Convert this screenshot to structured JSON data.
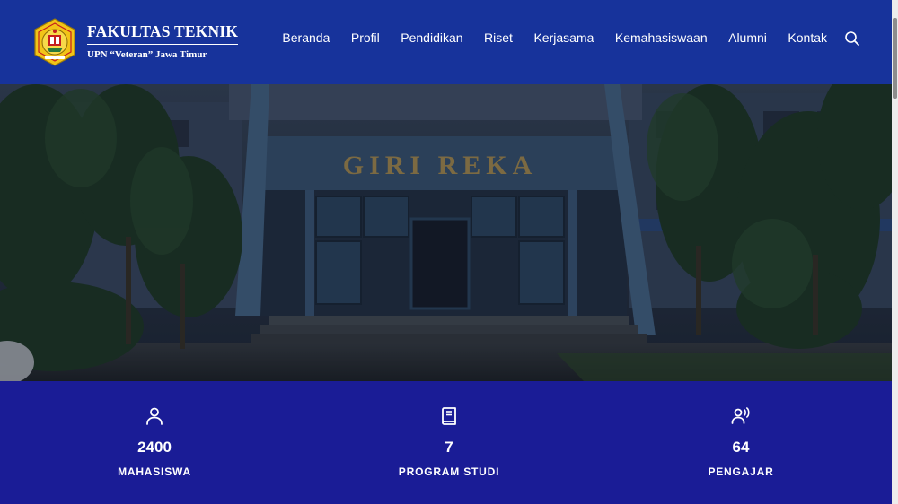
{
  "brand": {
    "title": "FAKULTAS TEKNIK",
    "subtitle": "UPN “Veteran” Jawa Timur",
    "logo_icon": "university-seal-logo"
  },
  "nav": {
    "items": [
      {
        "label": "Beranda"
      },
      {
        "label": "Profil"
      },
      {
        "label": "Pendidikan"
      },
      {
        "label": "Riset"
      },
      {
        "label": "Kerjasama"
      },
      {
        "label": "Kemahasiswaan"
      },
      {
        "label": "Alumni"
      },
      {
        "label": "Kontak"
      }
    ],
    "search_icon": "search-icon"
  },
  "hero": {
    "building_sign": "GIRI REKA"
  },
  "stats": [
    {
      "icon": "user-icon",
      "number": "2400",
      "label": "MAHASISWA"
    },
    {
      "icon": "book-icon",
      "number": "7",
      "label": "PROGRAM STUDI"
    },
    {
      "icon": "speaker-person-icon",
      "number": "64",
      "label": "PENGAJAR"
    }
  ],
  "colors": {
    "header_bg": "#17339b",
    "stats_bg": "#1a1c96",
    "text": "#ffffff",
    "logo_yellow": "#f2c418"
  }
}
